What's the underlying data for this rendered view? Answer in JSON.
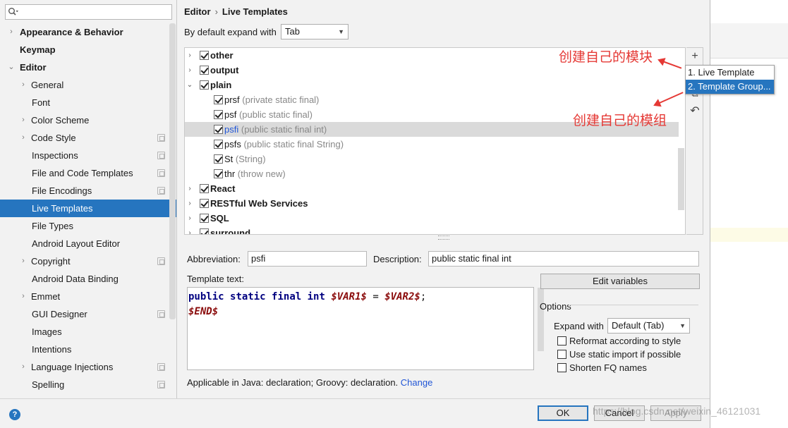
{
  "sidebar": {
    "search_placeholder": "",
    "items": [
      {
        "label": "Appearance & Behavior",
        "expander": "›",
        "bold": true
      },
      {
        "label": "Keymap",
        "expander": "",
        "bold": true
      },
      {
        "label": "Editor",
        "expander": "⌄",
        "bold": true
      },
      {
        "label": "General",
        "expander": "›"
      },
      {
        "label": "Font",
        "expander": ""
      },
      {
        "label": "Color Scheme",
        "expander": "›"
      },
      {
        "label": "Code Style",
        "expander": "›"
      },
      {
        "label": "Inspections",
        "expander": ""
      },
      {
        "label": "File and Code Templates",
        "expander": ""
      },
      {
        "label": "File Encodings",
        "expander": ""
      },
      {
        "label": "Live Templates",
        "expander": ""
      },
      {
        "label": "File Types",
        "expander": ""
      },
      {
        "label": "Android Layout Editor",
        "expander": ""
      },
      {
        "label": "Copyright",
        "expander": "›"
      },
      {
        "label": "Android Data Binding",
        "expander": ""
      },
      {
        "label": "Emmet",
        "expander": "›"
      },
      {
        "label": "GUI Designer",
        "expander": ""
      },
      {
        "label": "Images",
        "expander": ""
      },
      {
        "label": "Intentions",
        "expander": ""
      },
      {
        "label": "Language Injections",
        "expander": "›"
      },
      {
        "label": "Spelling",
        "expander": ""
      }
    ]
  },
  "breadcrumb": {
    "parent": "Editor",
    "separator": "›",
    "current": "Live Templates"
  },
  "expand": {
    "label": "By default expand with",
    "value": "Tab"
  },
  "tree": {
    "rows": [
      {
        "name": "other",
        "desc": "",
        "group": true,
        "expander": "›"
      },
      {
        "name": "output",
        "desc": "",
        "group": true,
        "expander": "›"
      },
      {
        "name": "plain",
        "desc": "",
        "group": true,
        "expander": "⌄"
      },
      {
        "name": "prsf",
        "desc": "(private static final)"
      },
      {
        "name": "psf",
        "desc": "(public static final)"
      },
      {
        "name": "psfi",
        "desc": "(public static final int)"
      },
      {
        "name": "psfs",
        "desc": "(public static final String)"
      },
      {
        "name": "St",
        "desc": "(String)"
      },
      {
        "name": "thr",
        "desc": "(throw new)"
      },
      {
        "name": "React",
        "desc": "",
        "group": true,
        "expander": "›"
      },
      {
        "name": "RESTful Web Services",
        "desc": "",
        "group": true,
        "expander": "›"
      },
      {
        "name": "SQL",
        "desc": "",
        "group": true,
        "expander": "›"
      },
      {
        "name": "surround",
        "desc": "",
        "group": true,
        "expander": "›"
      }
    ]
  },
  "toolbar": {
    "add": "+",
    "copy": "⧉",
    "revert": "↶"
  },
  "popup_menu": {
    "items": [
      "1. Live Template",
      "2. Template Group..."
    ]
  },
  "annotations": {
    "module": "创建自己的模块",
    "group": "创建自己的模组"
  },
  "form": {
    "abbreviation_label": "Abbreviation:",
    "abbreviation_value": "psfi",
    "description_label": "Description:",
    "description_value": "public static final int",
    "template_text_label": "Template text:",
    "code": {
      "line1_kw1": "public",
      "line1_kw2": "static",
      "line1_kw3": "final",
      "line1_kw4": "int",
      "line1_var1": "$VAR1$",
      "line1_eq": " = ",
      "line1_var2": "$VAR2$",
      "line1_semi": ";",
      "line2_var": "$END$"
    },
    "edit_variables": "Edit variables",
    "options_label": "Options",
    "expand_with_label": "Expand with",
    "expand_with_value": "Default (Tab)",
    "reformat": "Reformat according to style",
    "static_import": "Use static import if possible",
    "shorten_fq": "Shorten FQ names",
    "applicable_text": "Applicable in Java: declaration; Groovy: declaration.",
    "change_link": "Change"
  },
  "dialog_buttons": {
    "ok": "OK",
    "cancel": "Cancel",
    "apply": "Apply"
  },
  "help": "?",
  "watermark": "https://blog.csdn.net/weixin_46121031",
  "colors": {
    "selection": "#2675bf",
    "annotation": "#e53935",
    "link": "#2156d6"
  }
}
